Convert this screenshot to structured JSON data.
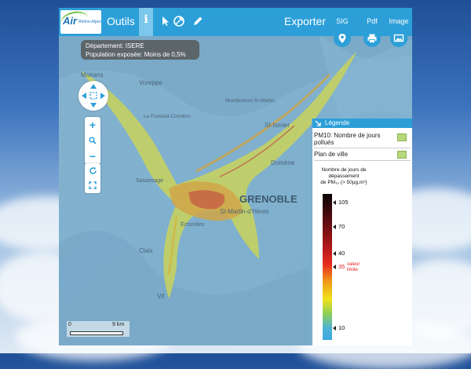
{
  "toolbar": {
    "logo_brand": "Air",
    "logo_subtitle": "Rhône-Alpes",
    "tools_label": "Outils",
    "info_label": "i",
    "export_label": "Exporter",
    "export_items": [
      {
        "label": "SIG",
        "icon": "map-pin-icon"
      },
      {
        "label": "Pdf",
        "icon": "printer-icon"
      },
      {
        "label": "Image",
        "icon": "image-icon"
      }
    ],
    "tool_icons": [
      "pointer-icon",
      "measure-icon",
      "pencil-icon"
    ],
    "accent": "#2c9fd8"
  },
  "tooltip": {
    "line1": "Département: ISERE",
    "line2": "Population exposée: Moins de 0,5%"
  },
  "map": {
    "labels": [
      {
        "text": "Moirans"
      },
      {
        "text": "Voreppe"
      },
      {
        "text": "Le Fontanil-Cornillon"
      },
      {
        "text": "St-Ismier"
      },
      {
        "text": "Domène"
      },
      {
        "text": "GRENOBLE"
      },
      {
        "text": "St-Martin-d'Hères"
      },
      {
        "text": "Échirolles"
      },
      {
        "text": "Sassenage"
      },
      {
        "text": "Claix"
      },
      {
        "text": "Vif"
      },
      {
        "text": "Montbonnot-St-Martin"
      }
    ],
    "scale": {
      "start": "0",
      "end": "9 km"
    }
  },
  "legend": {
    "title": "Légende",
    "layers": [
      {
        "label": "PM10: Nombre de jours pollués"
      },
      {
        "label": "Plan de ville"
      }
    ],
    "colorbar_title": [
      "Nombre de jours de",
      "dépassement",
      "de PM₁₀ (> 50µg.m³)"
    ],
    "ticks": [
      "105",
      "70",
      "40",
      "35",
      "10"
    ],
    "limit_value_label": [
      "valeur",
      "limite"
    ],
    "limit_color": "#e02020"
  }
}
